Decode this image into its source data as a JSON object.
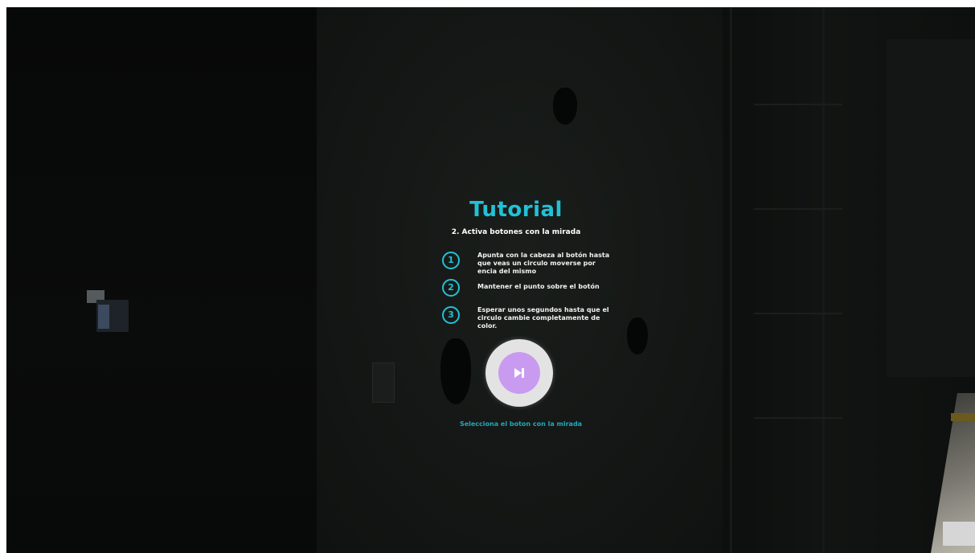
{
  "tutorial": {
    "title": "Tutorial",
    "subtitle": "2. Activa botones con la mirada",
    "steps": [
      {
        "number": "1",
        "text": "Apunta con la cabeza al botón hasta que veas un circulo moverse por encia del mismo"
      },
      {
        "number": "2",
        "text": "Mantener el punto sobre el botón"
      },
      {
        "number": "3",
        "text": "Esperar unos segundos hasta que el circulo cambie completamente de color."
      }
    ],
    "next_button": {
      "icon": "skip-next-icon"
    },
    "hint": "Selecciona el boton con la mirada"
  },
  "colors": {
    "accent": "#22c1d6",
    "button_ring": "#e3e3e3",
    "button_fill": "#c99bf0",
    "background": "#0c0e0d"
  }
}
